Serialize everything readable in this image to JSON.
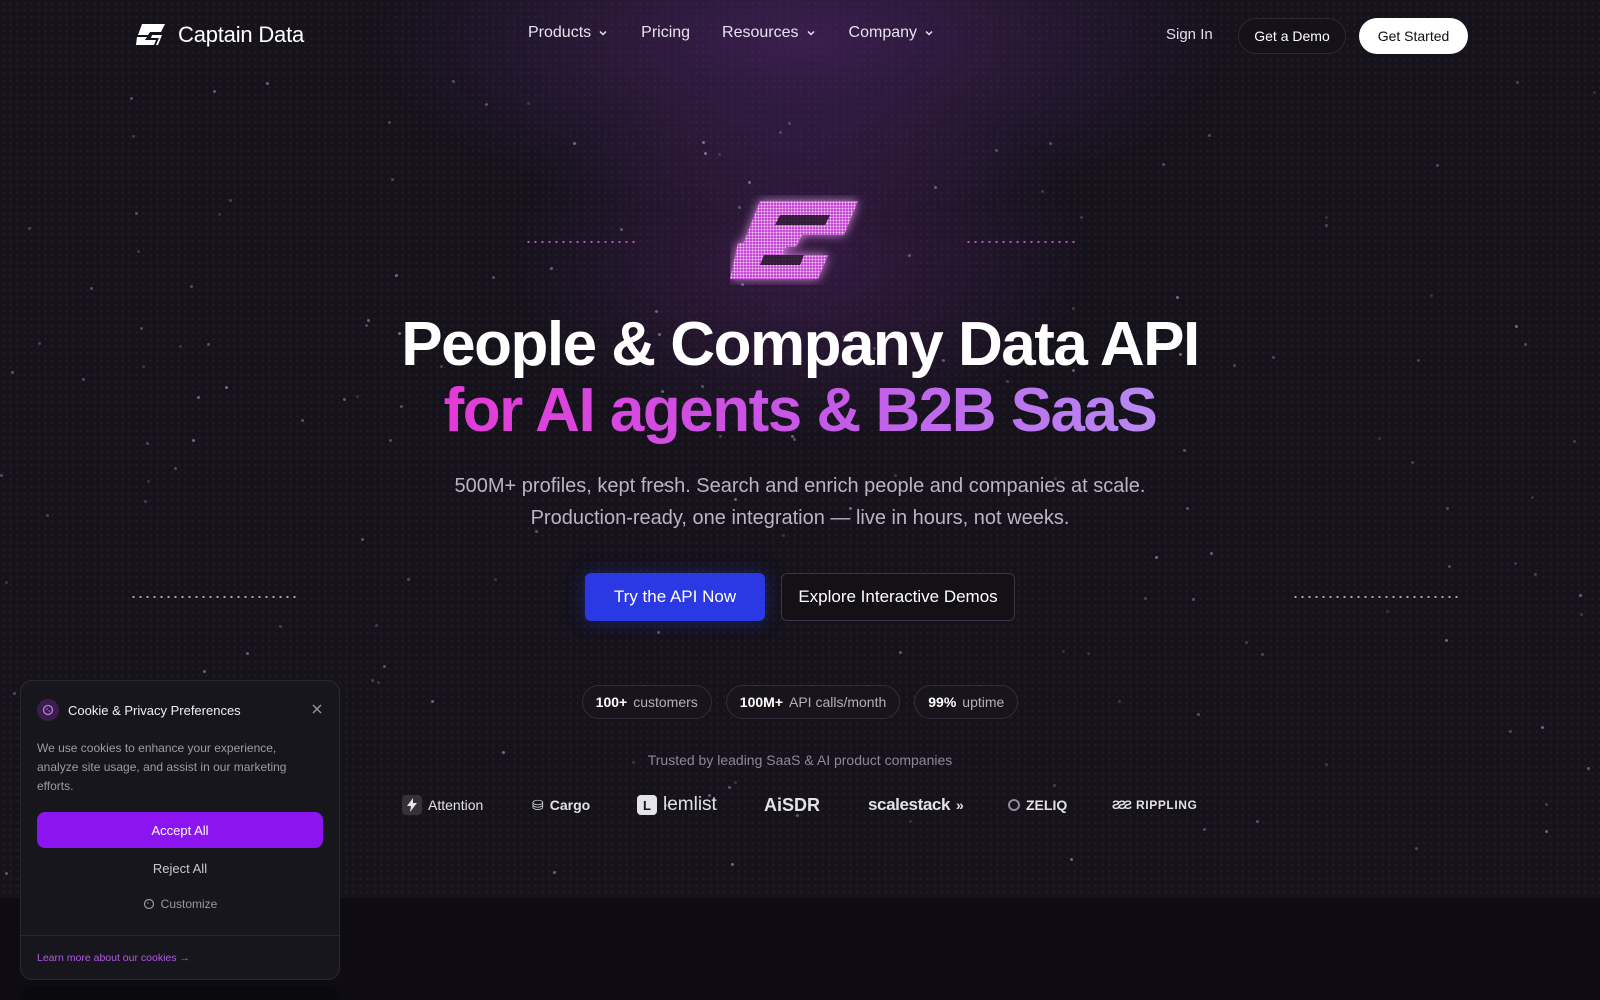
{
  "brand": {
    "name": "Captain Data",
    "accent": "#8c14f0",
    "primary_button": "#2a39e4"
  },
  "nav": {
    "links": [
      {
        "label": "Products",
        "has_menu": true
      },
      {
        "label": "Pricing",
        "has_menu": false
      },
      {
        "label": "Resources",
        "has_menu": true
      },
      {
        "label": "Company",
        "has_menu": true
      }
    ],
    "sign_in": "Sign In",
    "demo": "Get a Demo",
    "get_started": "Get Started"
  },
  "hero": {
    "title_line1": "People & Company Data API",
    "title_line2": "for AI agents & B2B SaaS",
    "subtitle": "500M+ profiles, kept fresh. Search and enrich people and companies at scale. Production-ready, one integration — live in hours, not weeks.",
    "primary_cta": "Try the API Now",
    "secondary_cta": "Explore Interactive Demos"
  },
  "stats": [
    {
      "value": "100+",
      "label": "customers"
    },
    {
      "value": "100M+",
      "label": "API calls/month"
    },
    {
      "value": "99%",
      "label": "uptime"
    }
  ],
  "trusted": {
    "heading": "Trusted by leading SaaS & AI product companies",
    "logos": [
      "Attention",
      "Cargo",
      "lemlist",
      "AiSDR",
      "scalestack",
      "ZELIQ",
      "RIPPLING"
    ]
  },
  "cookie": {
    "title": "Cookie & Privacy Preferences",
    "body": "We use cookies to enhance your experience, analyze site usage, and assist in our marketing efforts.",
    "accept": "Accept All",
    "reject": "Reject All",
    "customize": "Customize",
    "learn_more": "Learn more about our cookies →"
  }
}
